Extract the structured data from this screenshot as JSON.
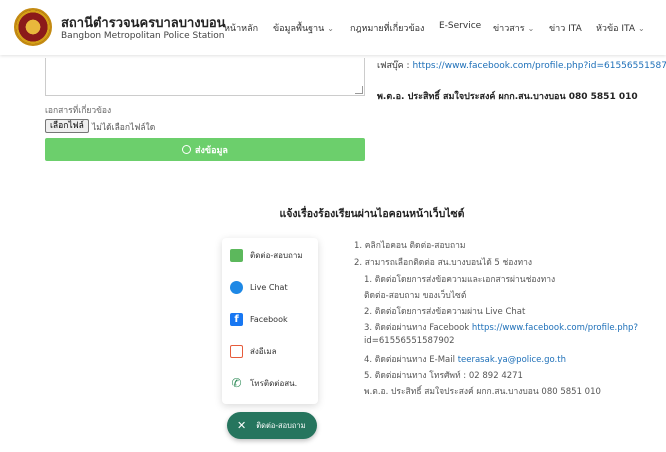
{
  "header": {
    "title": "สถานีตำรวจนครบาลบางบอน",
    "subtitle": "Bangbon Metropolitan Police Station",
    "nav": [
      {
        "label": "หน้าหลัก",
        "dropdown": false
      },
      {
        "label": "ข้อมูลพื้นฐาน",
        "dropdown": true
      },
      {
        "label": "กฎหมายที่เกี่ยวข้อง",
        "dropdown": false
      },
      {
        "label": "E-Service",
        "dropdown": false
      },
      {
        "label": "ข่าวสาร",
        "dropdown": true
      },
      {
        "label": "ข่าว ITA",
        "dropdown": false
      },
      {
        "label": "หัวข้อ ITA",
        "dropdown": true
      }
    ]
  },
  "form": {
    "doc_label": "เอกสารที่เกี่ยวข้อง",
    "file_button": "เลือกไฟล์",
    "file_none": "ไม่ได้เลือกไฟล์ใด",
    "submit_label": "ส่งข้อมูล"
  },
  "contact": {
    "facebook_label": "เฟสบุ๊ค :",
    "facebook_url": "https://www.facebook.com/profile.php?id=61556551587902",
    "officer": "พ.ต.อ. ประสิทธิ์ สมใจประสงค์ ผกก.สน.บางบอน 080 5851 010"
  },
  "section_heading": "แจ้งเรื่องร้องเรียนผ่านไอคอนหน้าเว็บไซต์",
  "widget": {
    "items": [
      {
        "label": "ติดต่อ-สอบถาม",
        "icon": "chat-icon"
      },
      {
        "label": "Live Chat",
        "icon": "messenger-icon"
      },
      {
        "label": "Facebook",
        "icon": "facebook-icon"
      },
      {
        "label": "ส่งอีเมล",
        "icon": "mail-icon"
      },
      {
        "label": "โทรติดต่อสน.",
        "icon": "phone-icon"
      }
    ],
    "fab_label": "ติดต่อ-สอบถาม"
  },
  "instructions": [
    "1. คลิกไอคอน ติดต่อ-สอบถาม",
    "2. สามารถเลือกติดต่อ สน.บางบอนได้ 5 ช่องทาง",
    "1. ติดต่อโดยการส่งข้อความและเอกสารผ่านช่องทาง",
    "ติดต่อ-สอบถาม ของเว็บไซต์",
    "2. ติดต่อโดยการส่งข้อความผ่าน Live Chat",
    "3. ติดต่อผ่านทาง Facebook",
    "https://www.facebook.com/profile.php?",
    "id=61556551587902",
    "4. ติดต่อผ่านทาง E-Mail",
    "teerasak.ya@police.go.th",
    "5. ติดต่อผ่านทาง โทรศัพท์ : 02 892 4271",
    "พ.ต.อ. ประสิทธิ์ สมใจประสงค์ ผกก.สน.บางบอน 080 5851 010"
  ]
}
